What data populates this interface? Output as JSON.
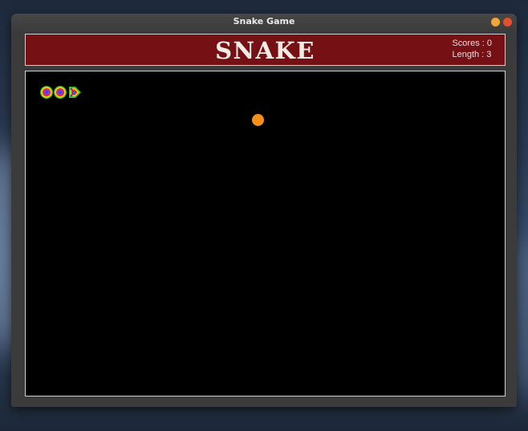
{
  "window": {
    "title": "Snake Game"
  },
  "header": {
    "title": "SNAKE",
    "scores_label": "Scores : 0",
    "length_label": "Length : 3"
  },
  "game": {
    "score": 0,
    "length": 3,
    "snake_direction": "right",
    "colors": {
      "board": "#000000",
      "header": "#751015",
      "food": "#f4901a",
      "snake_rings": [
        "#7a2bd6",
        "#2a5cff",
        "#e62a8a",
        "#e62020",
        "#ffd51a",
        "#3fbf2a"
      ]
    }
  },
  "icons": {
    "minimize": "minimize-icon",
    "close": "close-icon"
  }
}
